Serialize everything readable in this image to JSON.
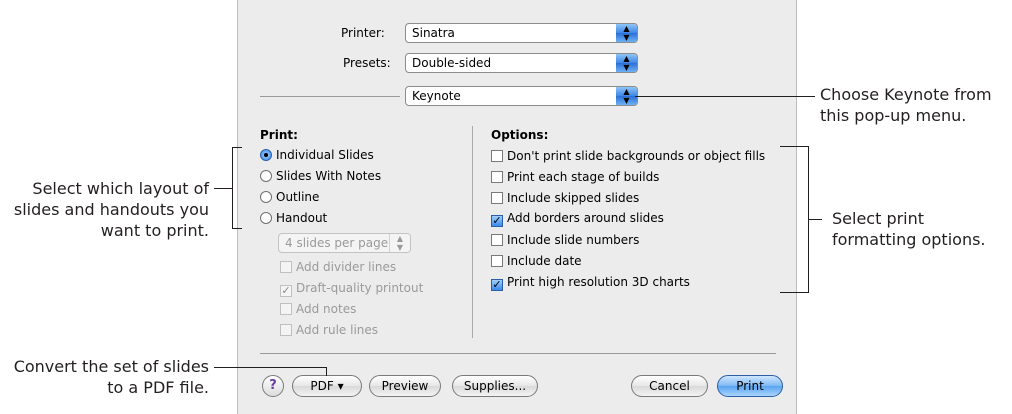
{
  "dialog": {
    "printer": {
      "label": "Printer:",
      "value": "Sinatra"
    },
    "presets": {
      "label": "Presets:",
      "value": "Double-sided"
    },
    "pane": {
      "value": "Keynote"
    },
    "print_section": {
      "title": "Print:",
      "options": [
        {
          "label": "Individual Slides",
          "selected": true
        },
        {
          "label": "Slides With Notes",
          "selected": false
        },
        {
          "label": "Outline",
          "selected": false
        },
        {
          "label": "Handout",
          "selected": false
        }
      ],
      "handout_layout": {
        "value": "4 slides per page"
      },
      "handout_options": [
        {
          "label": "Add divider lines",
          "checked": false
        },
        {
          "label": "Draft-quality printout",
          "checked": true
        },
        {
          "label": "Add notes",
          "checked": false
        },
        {
          "label": "Add rule lines",
          "checked": false
        }
      ]
    },
    "options_section": {
      "title": "Options:",
      "options": [
        {
          "label": "Don't print slide backgrounds or object fills",
          "checked": false
        },
        {
          "label": "Print each stage of builds",
          "checked": false
        },
        {
          "label": "Include skipped slides",
          "checked": false
        },
        {
          "label": "Add borders around slides",
          "checked": true
        },
        {
          "label": "Include slide numbers",
          "checked": false
        },
        {
          "label": "Include date",
          "checked": false
        },
        {
          "label": "Print high resolution 3D charts",
          "checked": true
        }
      ]
    },
    "buttons": {
      "help": "?",
      "pdf": "PDF ▾",
      "preview": "Preview",
      "supplies": "Supplies...",
      "cancel": "Cancel",
      "print": "Print"
    }
  },
  "callouts": {
    "choose_keynote": [
      "Choose Keynote from",
      "this pop-up menu."
    ],
    "select_layout": [
      "Select which layout of",
      "slides and handouts you",
      "want to print."
    ],
    "select_formatting": [
      "Select print",
      "formatting options."
    ],
    "convert_pdf": [
      "Convert the set of slides",
      "to a PDF file."
    ]
  }
}
